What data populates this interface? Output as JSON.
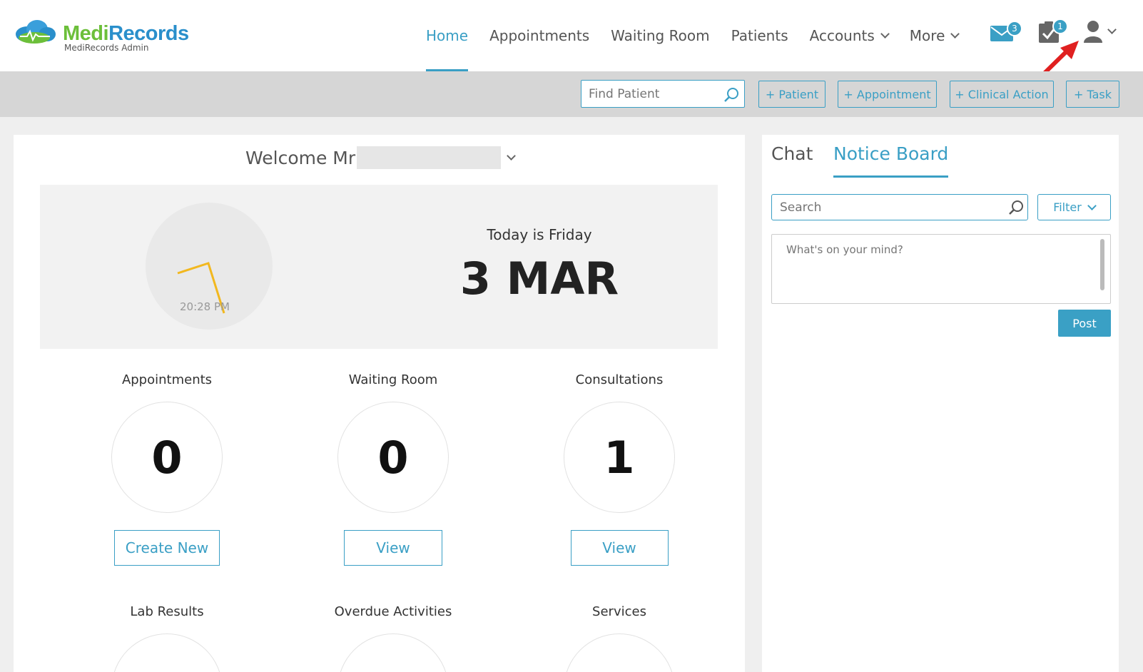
{
  "app": {
    "brand_part1": "Medi",
    "brand_part2": "Records",
    "subtitle": "MediRecords Admin"
  },
  "nav": {
    "home": "Home",
    "appointments": "Appointments",
    "waiting_room": "Waiting Room",
    "patients": "Patients",
    "accounts": "Accounts",
    "more": "More",
    "mail_badge": "3",
    "tasks_badge": "1"
  },
  "actionbar": {
    "find_placeholder": "Find Patient",
    "add_patient": "+ Patient",
    "add_appointment": "+ Appointment",
    "add_clinical_action": "+ Clinical Action",
    "add_task": "+ Task"
  },
  "welcome": {
    "greeting": "Welcome Mr"
  },
  "datebox": {
    "clock_time": "20:28 PM",
    "today": "Today is Friday",
    "date": "3 MAR"
  },
  "stats": [
    {
      "label": "Appointments",
      "value": "0",
      "button": "Create New"
    },
    {
      "label": "Waiting Room",
      "value": "0",
      "button": "View"
    },
    {
      "label": "Consultations",
      "value": "1",
      "button": "View"
    },
    {
      "label": "Lab Results"
    },
    {
      "label": "Overdue Activities"
    },
    {
      "label": "Services"
    }
  ],
  "side": {
    "tab_chat": "Chat",
    "tab_notice": "Notice Board",
    "search_placeholder": "Search",
    "filter": "Filter",
    "post_placeholder": "What's on your mind?",
    "post_button": "Post"
  },
  "colors": {
    "accent": "#3a9fc5",
    "brand_green": "#6cbf3a",
    "brand_blue": "#2a8fcb",
    "annotation_arrow": "#e02020"
  }
}
